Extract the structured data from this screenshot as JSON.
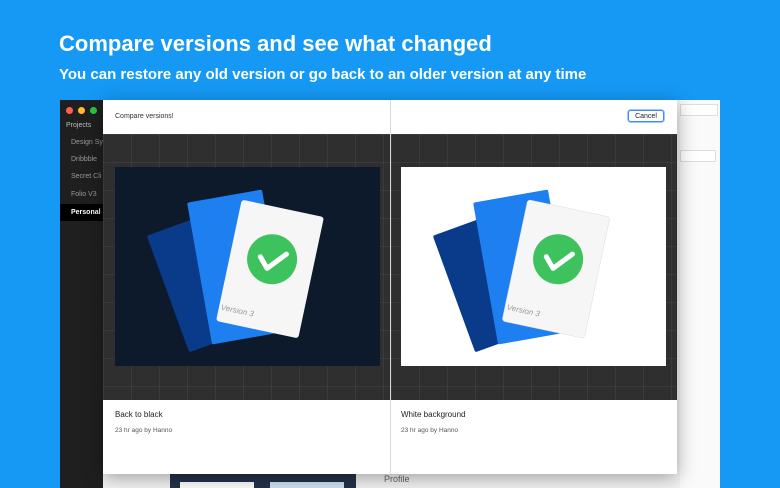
{
  "headline": "Compare versions and see what changed",
  "subline": "You can restore any old version or go back to an older version at any time",
  "app": {
    "sidebar_title": "Projects",
    "projects": [
      {
        "label": "Design Sys",
        "active": false
      },
      {
        "label": "Dribbble",
        "active": false
      },
      {
        "label": "Secret Cli",
        "active": false
      },
      {
        "label": "Folio V3",
        "active": false
      },
      {
        "label": "Personal",
        "active": true
      }
    ],
    "profile_label": "Profile",
    "traffic_colors": [
      "#ff5f57",
      "#febc2e",
      "#28c840"
    ]
  },
  "modal": {
    "title": "Compare versions!",
    "cancel_label": "Cancel",
    "versions": [
      {
        "name": "Back to black",
        "meta": "23 hr ago by Hanno",
        "card_text": "Version 3",
        "background": "#0d1a2b"
      },
      {
        "name": "White background",
        "meta": "23 hr ago by Hanno",
        "card_text": "Version 3",
        "background": "#ffffff"
      }
    ]
  },
  "colors": {
    "page_bg": "#1599f5",
    "accent": "#3d8bfd",
    "check_green": "#3ec25d"
  }
}
